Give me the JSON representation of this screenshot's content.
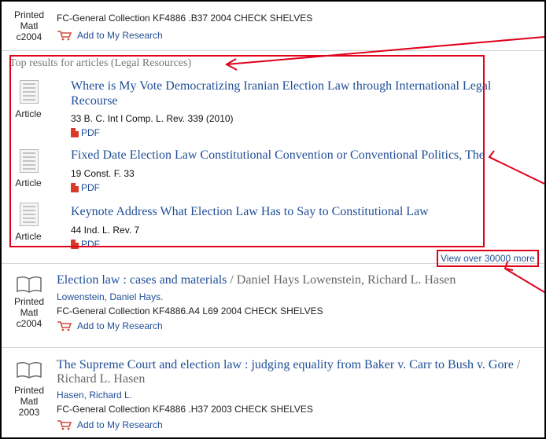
{
  "top_record": {
    "format_lines": [
      "Printed",
      "Matl",
      "c2004"
    ],
    "holding": "FC-General Collection  KF4886 .B37 2004   CHECK SHELVES",
    "add_label": "Add to My Research"
  },
  "articles_section": {
    "heading": "Top results for articles (Legal Resources)",
    "items": [
      {
        "type": "Article",
        "title_l1": "Where is My Vote Democratizing Iranian Election Law through International Legal",
        "title_l2": "Recourse",
        "citation": "33 B. C. Int l Comp. L. Rev. 339 (2010)",
        "pdf": "PDF"
      },
      {
        "type": "Article",
        "title_l1": "Fixed Date Election Law Constitutional Convention or Conventional Politics, The",
        "title_l2": "",
        "citation": "19 Const. F. 33",
        "pdf": "PDF"
      },
      {
        "type": "Article",
        "title_l1": "Keynote Address What Election Law Has to Say to Constitutional Law",
        "title_l2": "",
        "citation": "44 Ind. L. Rev. 7",
        "pdf": "PDF"
      }
    ],
    "more_link": "View over 30000 more"
  },
  "records": [
    {
      "format_lines": [
        "Printed",
        "Matl",
        "c2004"
      ],
      "title": "Election law : cases and materials",
      "authors": " / Daniel Hays Lowenstein, Richard L. Hasen",
      "author_link": "Lowenstein, Daniel Hays.",
      "holding": "FC-General Collection  KF4886.A4 L69 2004   CHECK SHELVES",
      "add_label": "Add to My Research"
    },
    {
      "format_lines": [
        "Printed",
        "Matl",
        "2003"
      ],
      "title": "The Supreme Court and election law : judging equality from Baker v. Carr to Bush v. Gore",
      "authors": " /",
      "authors_l2": "Richard L. Hasen",
      "author_link": "Hasen, Richard L.",
      "holding": "FC-General Collection  KF4886 .H37 2003   CHECK SHELVES",
      "add_label": "Add to My Research"
    }
  ],
  "colors": {
    "annotation": "#e0001b",
    "link": "#1f4e96"
  }
}
